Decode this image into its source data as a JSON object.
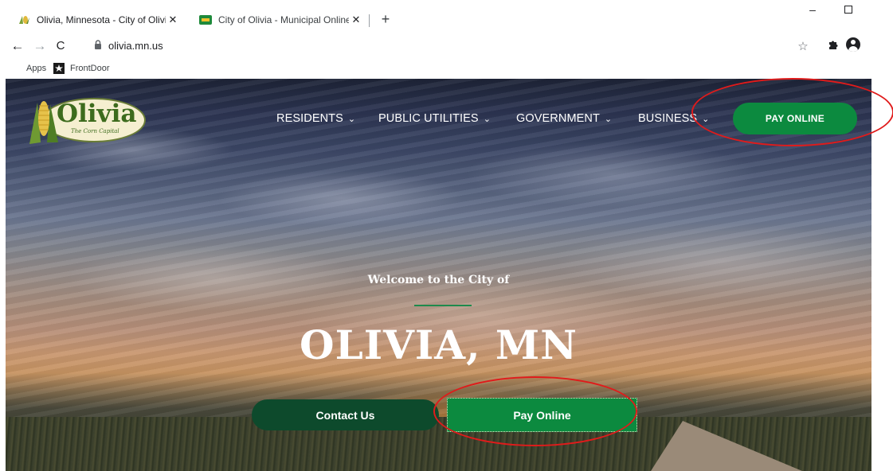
{
  "browser": {
    "tabs": [
      {
        "title": "Olivia, Minnesota - City of Olivia",
        "favicon": "corn-favicon-icon",
        "active": true
      },
      {
        "title": "City of Olivia - Municipal Online",
        "favicon": "municipal-favicon-icon",
        "active": false
      }
    ],
    "new_tab": "+",
    "window_controls": {
      "minimize": "–",
      "maximize": ""
    },
    "url": "olivia.mn.us",
    "bookmarks": [
      {
        "label": "Apps",
        "icon": "apps-grid-icon"
      },
      {
        "label": "FrontDoor",
        "icon": "frontdoor-icon"
      }
    ]
  },
  "site": {
    "logo": {
      "text": "Olivia",
      "tagline": "The Corn Capital"
    },
    "nav": [
      {
        "label": "RESIDENTS"
      },
      {
        "label": "PUBLIC UTILITIES"
      },
      {
        "label": "GOVERNMENT"
      },
      {
        "label": "BUSINESS"
      }
    ],
    "pay_online_top": "PAY ONLINE",
    "hero": {
      "welcome": "Welcome to the City of",
      "headline": "OLIVIA, MN",
      "contact_button": "Contact Us",
      "pay_button": "Pay Online"
    }
  },
  "colors": {
    "brand_green": "#0c8a3f",
    "dark_green": "#0d4a2c",
    "annotation_red": "#e01b1b"
  }
}
